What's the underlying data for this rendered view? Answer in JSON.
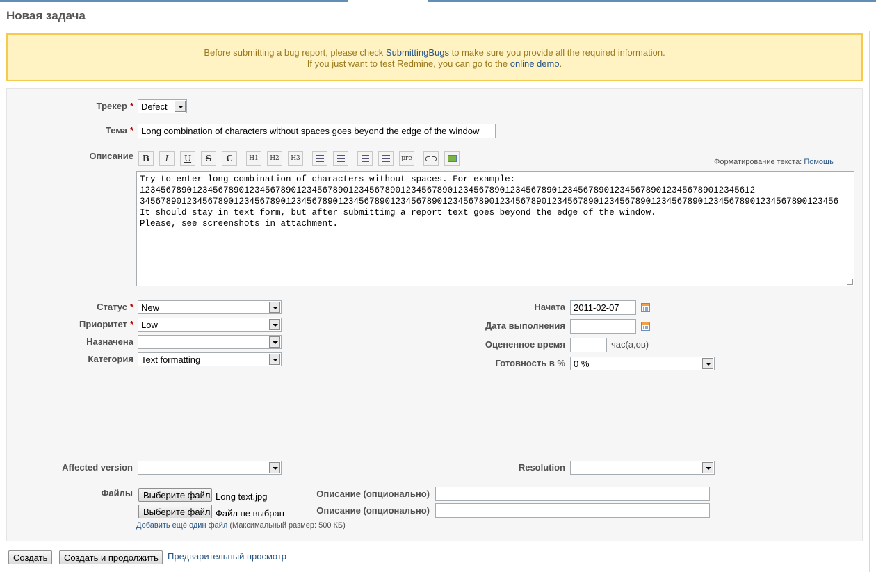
{
  "page": {
    "title": "Новая задача"
  },
  "flash": {
    "line1_before": "Before submitting a bug report, please check ",
    "line1_link": "SubmittingBugs",
    "line1_after": " to make sure you provide all the required information.",
    "line2_before": "If you just want to test Redmine, you can go to the ",
    "line2_link": "online demo",
    "line2_after": "."
  },
  "form": {
    "tracker": {
      "label": "Трекер",
      "value": "Defect"
    },
    "subject": {
      "label": "Тема",
      "value": "Long combination of characters without spaces goes beyond the edge of the window"
    },
    "description": {
      "label": "Описание",
      "lines": [
        "Try to enter long combination of characters without spaces. For example:",
        "1234567890123456789012345678901234567890123456789012345678901234567890123456789012345678901234567890123456789012345612",
        "34567890123456789012345678901234567890123456789012345678901234567890123456789012345678901234567890123456789012345678901234567890123456",
        "",
        "It should stay in text form, but after submittimg a report text goes beyond the edge of the window.",
        "",
        "Please, see screenshots in attachment."
      ]
    },
    "toolbar": {
      "bold": "B",
      "italic": "I",
      "underline": "U",
      "strike": "S",
      "code": "C",
      "h1": "H1",
      "h2": "H2",
      "h3": "H3",
      "pre": "pre"
    },
    "formatting": {
      "label": "Форматирование текста: ",
      "help": "Помощь"
    },
    "status": {
      "label": "Статус",
      "value": "New"
    },
    "priority": {
      "label": "Приоритет",
      "value": "Low"
    },
    "assigned": {
      "label": "Назначена",
      "value": ""
    },
    "category": {
      "label": "Категория",
      "value": "Text formatting"
    },
    "start_date": {
      "label": "Начата",
      "value": "2011-02-07"
    },
    "due_date": {
      "label": "Дата выполнения",
      "value": ""
    },
    "estimated": {
      "label": "Оцененное время",
      "value": "",
      "unit": "час(а,ов)"
    },
    "done_ratio": {
      "label": "Готовность в %",
      "value": "0 %"
    },
    "affected_version": {
      "label": "Affected version",
      "value": ""
    },
    "resolution": {
      "label": "Resolution",
      "value": ""
    },
    "files": {
      "label": "Файлы",
      "choose_label": "Выберите файл",
      "rows": [
        {
          "filename": "Long text.jpg",
          "desc_label": "Описание (опционально)"
        },
        {
          "filename": "Файл не выбран",
          "desc_label": "Описание (опционально)"
        }
      ],
      "add_link": "Добавить ещё один файл",
      "max_size": " (Максимальный размер: 500 КБ)"
    }
  },
  "actions": {
    "create": "Создать",
    "create_continue": "Создать и продолжить",
    "preview": "Предварительный просмотр"
  }
}
